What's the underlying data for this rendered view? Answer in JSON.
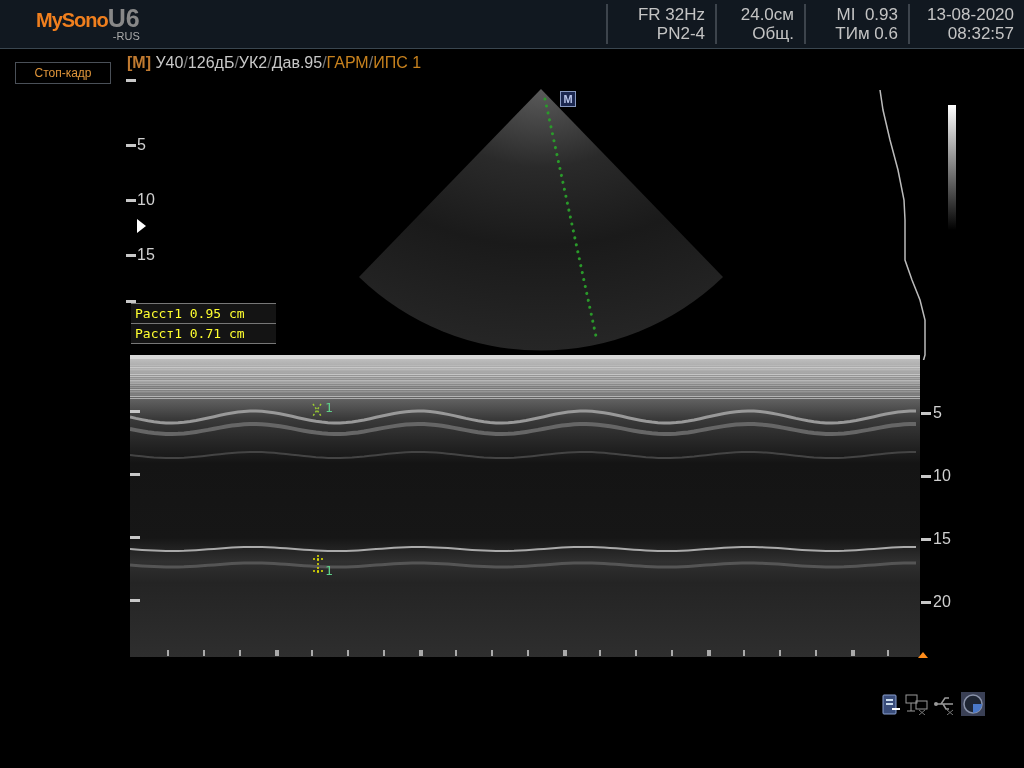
{
  "header": {
    "logo": "MySono",
    "model": "U6",
    "suffix": "-RUS",
    "info": [
      {
        "line1": "FR 32Hz",
        "line2": "PN2-4"
      },
      {
        "line1": "24.0см",
        "line2": "Общ."
      },
      {
        "line1": "MI  0.93",
        "line2": "ТИм 0.6"
      },
      {
        "line1": "13-08-2020",
        "line2": "08:32:57"
      }
    ]
  },
  "freeze_button": "Стоп-кадр",
  "parameters": [
    {
      "text": "[M]",
      "kind": "mode"
    },
    {
      "text": " У40",
      "kind": "value"
    },
    {
      "text": "/",
      "kind": "sep"
    },
    {
      "text": "126дБ",
      "kind": "value"
    },
    {
      "text": "/",
      "kind": "sep"
    },
    {
      "text": "УК2",
      "kind": "value"
    },
    {
      "text": "/",
      "kind": "sep"
    },
    {
      "text": "Дав.95",
      "kind": "value"
    },
    {
      "text": "/",
      "kind": "sep"
    },
    {
      "text": "ГАРМ",
      "kind": "accent"
    },
    {
      "text": "/",
      "kind": "sep"
    },
    {
      "text": "ИПС 1",
      "kind": "accent"
    }
  ],
  "b_mode": {
    "depth_labels": [
      "5",
      "10",
      "15"
    ],
    "m_marker": "M"
  },
  "measurements": [
    {
      "label": "Расст1 0.95 cm"
    },
    {
      "label": "Расст1 0.71 cm"
    }
  ],
  "m_mode": {
    "depth_labels": [
      "5",
      "10",
      "15",
      "20"
    ],
    "caliper_labels": [
      "1",
      "1"
    ]
  }
}
